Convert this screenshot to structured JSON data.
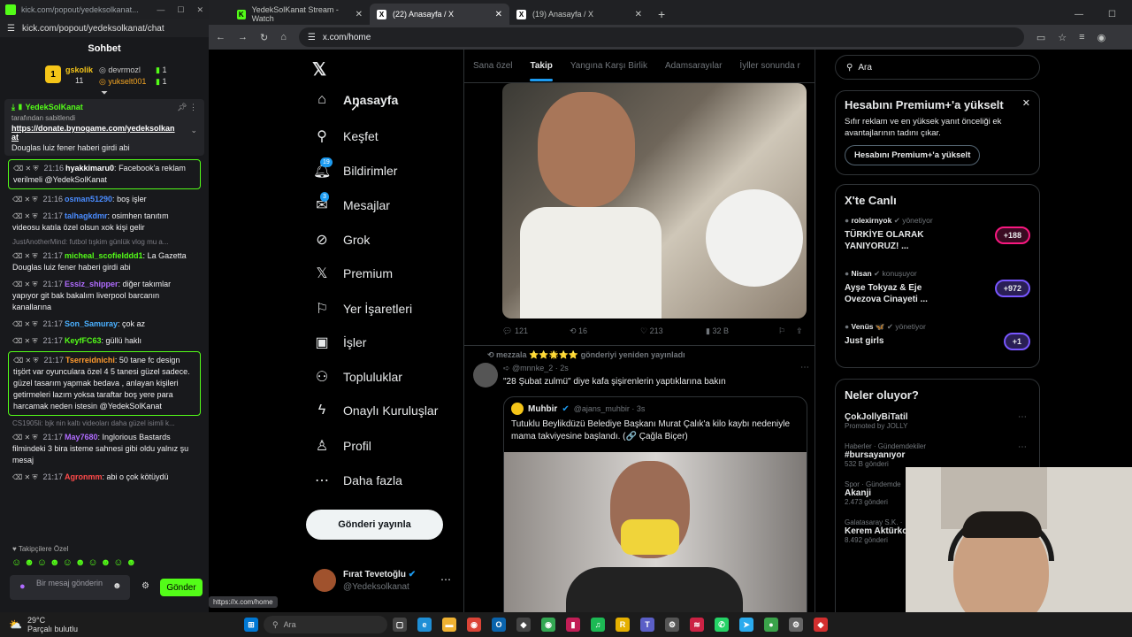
{
  "chat_window": {
    "title": "kick.com/popout/yedeksolkanat...",
    "address": "kick.com/popout/yedeksolkanat/chat",
    "header": "Sohbet",
    "gifters": [
      {
        "rank": "1",
        "name": "gskolik",
        "count": "11"
      },
      {
        "name": "devrmozl",
        "count": "1"
      },
      {
        "name": "yukselt001",
        "count": "1"
      }
    ],
    "pinned": {
      "user": "YedekSolKanat",
      "by": "tarafından sabitlendi",
      "link": "https://donate.bynogame.com/yedeksolkanat",
      "tail": "Douglas luiz fener haberi girdi abi"
    },
    "messages": [
      {
        "time": "21:16",
        "user": "hyakkimaru0",
        "text": "Facebook'a reklam verilmeli @YedekSolKanat",
        "color": "#ffffff",
        "hl": true
      },
      {
        "time": "21:16",
        "user": "osman51290",
        "text": "boş işler",
        "color": "#4a8cff",
        "hl": false
      },
      {
        "time": "21:17",
        "user": "talhagkdmr",
        "text": "osimhen tanıtım videosu katıla özel olsun xok kişi gelir",
        "color": "#4a8cff",
        "hl": false
      },
      {
        "time": "21:17",
        "user": "micheal_scofielddd1",
        "text": "La Gazetta Douglas luiz fener haberi girdi abi",
        "color": "#53fc18",
        "hl": false
      },
      {
        "time": "21:17",
        "user": "Essiz_shipper",
        "text": "diğer takımlar yapıyor git bak bakalım liverpool barcanın kanallarına",
        "color": "#b06cff",
        "hl": false
      },
      {
        "time": "21:17",
        "user": "Son_Samuray",
        "text": "çok az",
        "color": "#4ab0ff",
        "hl": false
      },
      {
        "time": "21:17",
        "user": "KeyfFC63",
        "text": "güllü haklı",
        "color": "#53fc18",
        "hl": false
      },
      {
        "time": "21:17",
        "user": "Tserreidnichi",
        "text": "50 tane fc design tişört var oyunculara özel 4 5 tanesi güzel sadece. güzel tasarım yapmak bedava , anlayan kişileri getirmeleri lazım yoksa taraftar boş yere para harcamak neden istesin @YedekSolKanat",
        "color": "#ff9a2e",
        "hl": true
      },
      {
        "time": "21:17",
        "user": "May7680",
        "text": "Inglorious Bastards filmindeki 3 bira isteme sahnesi gibi oldu yalnız şu mesaj",
        "color": "#b06cff",
        "hl": false
      },
      {
        "time": "21:17",
        "user": "Agronmm",
        "text": "abi o çok kötüydü",
        "color": "#ff4a4a",
        "hl": false
      }
    ],
    "system_lines": [
      "JustAnotherMind: futbol tışkim günlük vlog mu a...",
      "CS1905li: bjk nin kaltı videoları daha güzel isimli k..."
    ],
    "followers_only": "Takipçilere Özel",
    "input_placeholder": "Bir mesaj gönderin",
    "send_label": "Gönder"
  },
  "browser": {
    "tabs": [
      {
        "title": "YedekSolKanat Stream - Watch",
        "icon": "K",
        "color": "#53fc18"
      },
      {
        "title": "(22) Anasayfa / X",
        "icon": "X",
        "color": "#000000"
      },
      {
        "title": "(19) Anasayfa / X",
        "icon": "X",
        "color": "#000000"
      }
    ],
    "new_tab": "+",
    "url": "x.com/home",
    "status_url": "https://x.com/home"
  },
  "x_nav": {
    "items": [
      {
        "label": "Anasayfa",
        "icon": "home-icon",
        "glyph": "⌂",
        "badge": ""
      },
      {
        "label": "Keşfet",
        "icon": "search-icon",
        "glyph": "⚲",
        "badge": ""
      },
      {
        "label": "Bildirimler",
        "icon": "bell-icon",
        "glyph": "🔔︎",
        "badge": "19"
      },
      {
        "label": "Mesajlar",
        "icon": "mail-icon",
        "glyph": "✉",
        "badge": "3"
      },
      {
        "label": "Grok",
        "icon": "grok-icon",
        "glyph": "⊘",
        "badge": ""
      },
      {
        "label": "Premium",
        "icon": "x-premium-icon",
        "glyph": "𝕏",
        "badge": ""
      },
      {
        "label": "Yer İşaretleri",
        "icon": "bookmark-icon",
        "glyph": "⚐",
        "badge": ""
      },
      {
        "label": "İşler",
        "icon": "briefcase-icon",
        "glyph": "▣",
        "badge": ""
      },
      {
        "label": "Topluluklar",
        "icon": "communities-icon",
        "glyph": "⚇",
        "badge": ""
      },
      {
        "label": "Onaylı Kuruluşlar",
        "icon": "lightning-icon",
        "glyph": "ϟ",
        "badge": ""
      },
      {
        "label": "Profil",
        "icon": "profile-icon",
        "glyph": "♙",
        "badge": ""
      },
      {
        "label": "Daha fazla",
        "icon": "more-icon",
        "glyph": "⋯",
        "badge": ""
      }
    ],
    "post_button": "Gönderi yayınla",
    "profile": {
      "name": "Fırat Tevetoğlu",
      "handle": "@Yedeksolkanat"
    }
  },
  "timeline": {
    "tabs": [
      "Sana özel",
      "Takip",
      "Yangına Karşı Birlik",
      "Adamsarayılar",
      "İyller sonunda r"
    ],
    "active_tab": "Takip",
    "post1_actions": {
      "replies": "121",
      "reposts": "16",
      "likes": "213",
      "views": "32 B"
    },
    "post2": {
      "repost_by": "mezzala ⭐⭐🌟⭐⭐ gönderiyi yeniden yayınladı",
      "handle": "@mnnke_2 · 2s",
      "text": "\"28 Şubat zulmü\" diye kafa şişirenlerin yaptıklarına bakın",
      "quote_name": "Muhbir",
      "quote_handle": "@ajans_muhbir · 3s",
      "quote_text": "Tutuklu Beylikdüzü Belediye Başkanı Murat Çalık'a kilo kaybı nedeniyle mama takviyesine başlandı. (🔗 Çağla Biçer)"
    }
  },
  "right": {
    "search_placeholder": "Ara",
    "premium": {
      "title": "Hesabını Premium+'a yükselt",
      "body": "Sıfır reklam ve en yüksek yanıt önceliği ek avantajlarının tadını çıkar.",
      "button": "Hesabını Premium+'a yükselt"
    },
    "live": {
      "title": "X'te Canlı",
      "items": [
        {
          "host": "rolexirnyok",
          "role": "yönetiyor",
          "title": "TÜRKİYE OLARAK YANIYORUZ! ...",
          "count": "+188"
        },
        {
          "host": "Nisan",
          "role": "konuşuyor",
          "title": "Ayşe Tokyaz & Eje Ovezova Cinayeti ...",
          "count": "+972"
        },
        {
          "host": "Venüs 🦋",
          "role": "yönetiyor",
          "title": "Just girls",
          "count": "+1"
        }
      ]
    },
    "trends": {
      "title": "Neler oluyor?",
      "items": [
        {
          "sub": "",
          "name": "ÇokJollyBiTatil",
          "meta": "Promoted by JOLLY"
        },
        {
          "sub": "Haberler · Gündemdekiler",
          "name": "#bursayanıyor",
          "meta": "532 B gönderi"
        },
        {
          "sub": "Spor · Gündemde",
          "name": "Akanji",
          "meta": "2.473 gönderi"
        },
        {
          "sub": "Galatasaray S.K. · ",
          "name": "Kerem Aktürko",
          "meta": "8.492 gönderi"
        }
      ]
    }
  },
  "taskbar": {
    "weather_temp": "29°C",
    "weather_text": "Parçalı bulutlu",
    "search_placeholder": "Ara"
  }
}
